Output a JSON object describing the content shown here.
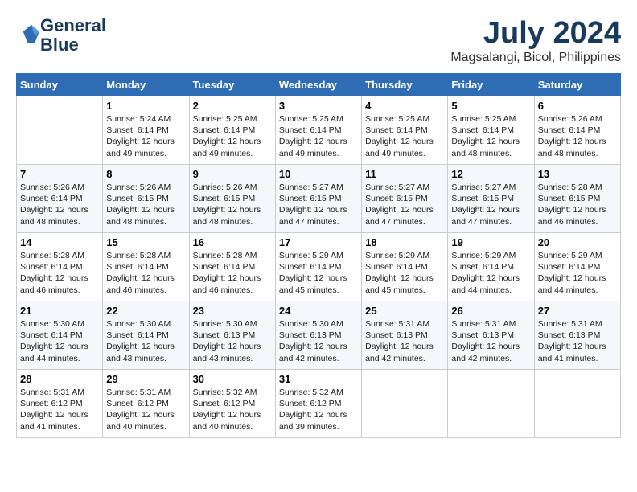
{
  "header": {
    "logo_line1": "General",
    "logo_line2": "Blue",
    "month_year": "July 2024",
    "location": "Magsalangi, Bicol, Philippines"
  },
  "weekdays": [
    "Sunday",
    "Monday",
    "Tuesday",
    "Wednesday",
    "Thursday",
    "Friday",
    "Saturday"
  ],
  "weeks": [
    [
      {
        "day": "",
        "info": ""
      },
      {
        "day": "1",
        "info": "Sunrise: 5:24 AM\nSunset: 6:14 PM\nDaylight: 12 hours\nand 49 minutes."
      },
      {
        "day": "2",
        "info": "Sunrise: 5:25 AM\nSunset: 6:14 PM\nDaylight: 12 hours\nand 49 minutes."
      },
      {
        "day": "3",
        "info": "Sunrise: 5:25 AM\nSunset: 6:14 PM\nDaylight: 12 hours\nand 49 minutes."
      },
      {
        "day": "4",
        "info": "Sunrise: 5:25 AM\nSunset: 6:14 PM\nDaylight: 12 hours\nand 49 minutes."
      },
      {
        "day": "5",
        "info": "Sunrise: 5:25 AM\nSunset: 6:14 PM\nDaylight: 12 hours\nand 48 minutes."
      },
      {
        "day": "6",
        "info": "Sunrise: 5:26 AM\nSunset: 6:14 PM\nDaylight: 12 hours\nand 48 minutes."
      }
    ],
    [
      {
        "day": "7",
        "info": "Sunrise: 5:26 AM\nSunset: 6:14 PM\nDaylight: 12 hours\nand 48 minutes."
      },
      {
        "day": "8",
        "info": "Sunrise: 5:26 AM\nSunset: 6:15 PM\nDaylight: 12 hours\nand 48 minutes."
      },
      {
        "day": "9",
        "info": "Sunrise: 5:26 AM\nSunset: 6:15 PM\nDaylight: 12 hours\nand 48 minutes."
      },
      {
        "day": "10",
        "info": "Sunrise: 5:27 AM\nSunset: 6:15 PM\nDaylight: 12 hours\nand 47 minutes."
      },
      {
        "day": "11",
        "info": "Sunrise: 5:27 AM\nSunset: 6:15 PM\nDaylight: 12 hours\nand 47 minutes."
      },
      {
        "day": "12",
        "info": "Sunrise: 5:27 AM\nSunset: 6:15 PM\nDaylight: 12 hours\nand 47 minutes."
      },
      {
        "day": "13",
        "info": "Sunrise: 5:28 AM\nSunset: 6:15 PM\nDaylight: 12 hours\nand 46 minutes."
      }
    ],
    [
      {
        "day": "14",
        "info": "Sunrise: 5:28 AM\nSunset: 6:14 PM\nDaylight: 12 hours\nand 46 minutes."
      },
      {
        "day": "15",
        "info": "Sunrise: 5:28 AM\nSunset: 6:14 PM\nDaylight: 12 hours\nand 46 minutes."
      },
      {
        "day": "16",
        "info": "Sunrise: 5:28 AM\nSunset: 6:14 PM\nDaylight: 12 hours\nand 46 minutes."
      },
      {
        "day": "17",
        "info": "Sunrise: 5:29 AM\nSunset: 6:14 PM\nDaylight: 12 hours\nand 45 minutes."
      },
      {
        "day": "18",
        "info": "Sunrise: 5:29 AM\nSunset: 6:14 PM\nDaylight: 12 hours\nand 45 minutes."
      },
      {
        "day": "19",
        "info": "Sunrise: 5:29 AM\nSunset: 6:14 PM\nDaylight: 12 hours\nand 44 minutes."
      },
      {
        "day": "20",
        "info": "Sunrise: 5:29 AM\nSunset: 6:14 PM\nDaylight: 12 hours\nand 44 minutes."
      }
    ],
    [
      {
        "day": "21",
        "info": "Sunrise: 5:30 AM\nSunset: 6:14 PM\nDaylight: 12 hours\nand 44 minutes."
      },
      {
        "day": "22",
        "info": "Sunrise: 5:30 AM\nSunset: 6:14 PM\nDaylight: 12 hours\nand 43 minutes."
      },
      {
        "day": "23",
        "info": "Sunrise: 5:30 AM\nSunset: 6:13 PM\nDaylight: 12 hours\nand 43 minutes."
      },
      {
        "day": "24",
        "info": "Sunrise: 5:30 AM\nSunset: 6:13 PM\nDaylight: 12 hours\nand 42 minutes."
      },
      {
        "day": "25",
        "info": "Sunrise: 5:31 AM\nSunset: 6:13 PM\nDaylight: 12 hours\nand 42 minutes."
      },
      {
        "day": "26",
        "info": "Sunrise: 5:31 AM\nSunset: 6:13 PM\nDaylight: 12 hours\nand 42 minutes."
      },
      {
        "day": "27",
        "info": "Sunrise: 5:31 AM\nSunset: 6:13 PM\nDaylight: 12 hours\nand 41 minutes."
      }
    ],
    [
      {
        "day": "28",
        "info": "Sunrise: 5:31 AM\nSunset: 6:12 PM\nDaylight: 12 hours\nand 41 minutes."
      },
      {
        "day": "29",
        "info": "Sunrise: 5:31 AM\nSunset: 6:12 PM\nDaylight: 12 hours\nand 40 minutes."
      },
      {
        "day": "30",
        "info": "Sunrise: 5:32 AM\nSunset: 6:12 PM\nDaylight: 12 hours\nand 40 minutes."
      },
      {
        "day": "31",
        "info": "Sunrise: 5:32 AM\nSunset: 6:12 PM\nDaylight: 12 hours\nand 39 minutes."
      },
      {
        "day": "",
        "info": ""
      },
      {
        "day": "",
        "info": ""
      },
      {
        "day": "",
        "info": ""
      }
    ]
  ]
}
